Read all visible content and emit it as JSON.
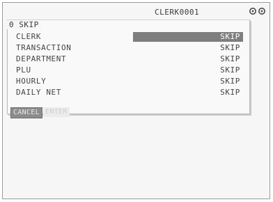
{
  "status_bar": {
    "clerk_code": "CLERK0001",
    "mode_icon": "double-circle-icon"
  },
  "panel": {
    "title": "0 SKIP"
  },
  "menu": {
    "rows": [
      {
        "label": "CLERK",
        "value": "SKIP",
        "selected": true
      },
      {
        "label": "TRANSACTION",
        "value": "SKIP",
        "selected": false
      },
      {
        "label": "DEPARTMENT",
        "value": "SKIP",
        "selected": false
      },
      {
        "label": "PLU",
        "value": "SKIP",
        "selected": false
      },
      {
        "label": "HOURLY",
        "value": "SKIP",
        "selected": false
      },
      {
        "label": "DAILY NET",
        "value": "SKIP",
        "selected": false
      }
    ]
  },
  "softkeys": {
    "cancel": "CANCEL",
    "enter": "ENTER"
  },
  "colors": {
    "highlight": "#7e7e7e",
    "text": "#444444",
    "background": "#f6f6f6"
  }
}
